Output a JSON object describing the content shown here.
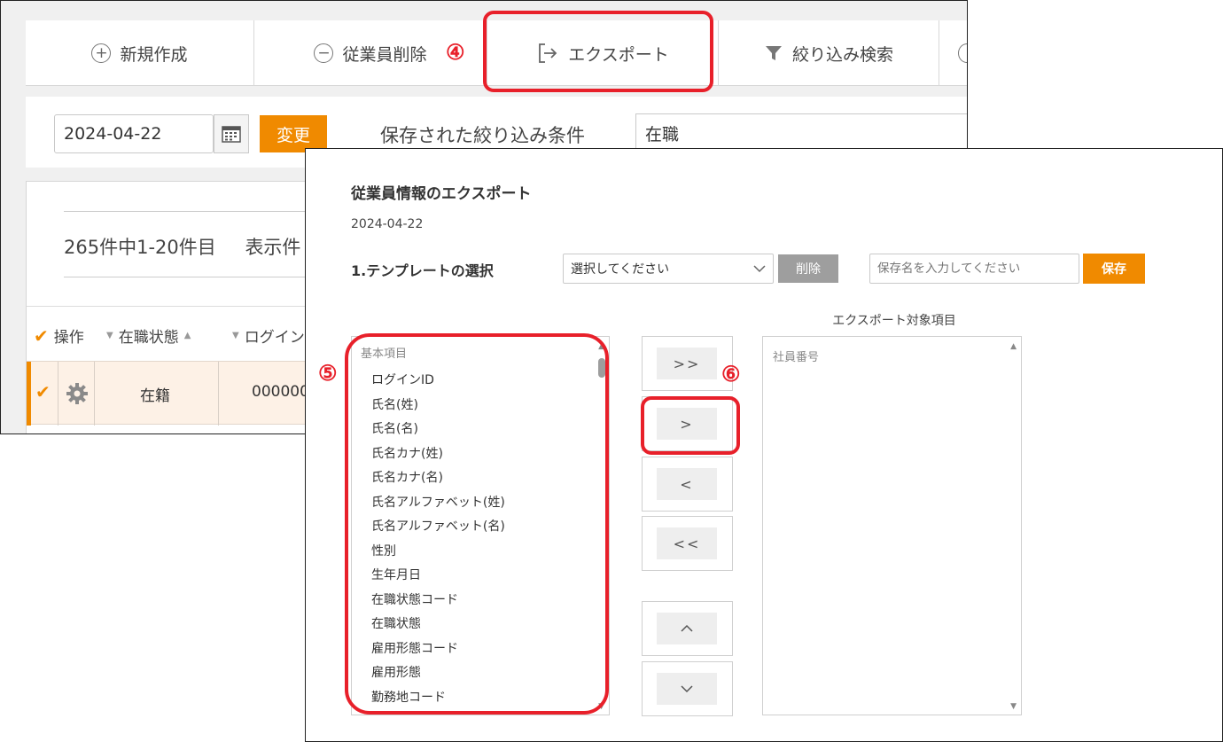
{
  "toolbar": {
    "new_label": "新規作成",
    "delete_employee_label": "従業員削除",
    "export_label": "エクスポート",
    "filter_label": "絞り込み検索"
  },
  "annotations": {
    "step4": "④",
    "step5": "⑤",
    "step6": "⑥"
  },
  "filter": {
    "date_value": "2024-04-22",
    "change_label": "変更",
    "saved_conditions_label": "保存された絞り込み条件",
    "saved_conditions_value": "在職"
  },
  "list": {
    "count_text": "265件中1-20件目",
    "display_label": "表示件",
    "columns": [
      "操作",
      "在職状態",
      "ログイン"
    ],
    "row": {
      "status": "在籍",
      "login_id": "000000"
    }
  },
  "modal": {
    "title": "従業員情報のエクスポート",
    "date": "2024-04-22",
    "template_label": "1.テンプレートの選択",
    "template_select": "選択してください",
    "template_delete": "削除",
    "save_name_placeholder": "保存名を入力してください",
    "template_save": "保存",
    "target_label": "エクスポート対象項目",
    "source_group": "基本項目",
    "source_items": [
      "ログインID",
      "氏名(姓)",
      "氏名(名)",
      "氏名カナ(姓)",
      "氏名カナ(名)",
      "氏名アルファベット(姓)",
      "氏名アルファベット(名)",
      "性別",
      "生年月日",
      "在職状態コード",
      "在職状態",
      "雇用形態コード",
      "雇用形態",
      "勤務地コード"
    ],
    "target_items": [
      "社員番号"
    ],
    "move_buttons": {
      "add_all": ">>",
      "add": ">",
      "remove": "<",
      "remove_all": "<<",
      "up": "^",
      "down": "v"
    }
  },
  "colors": {
    "accent": "#f08a00",
    "highlight": "#e8202a"
  }
}
